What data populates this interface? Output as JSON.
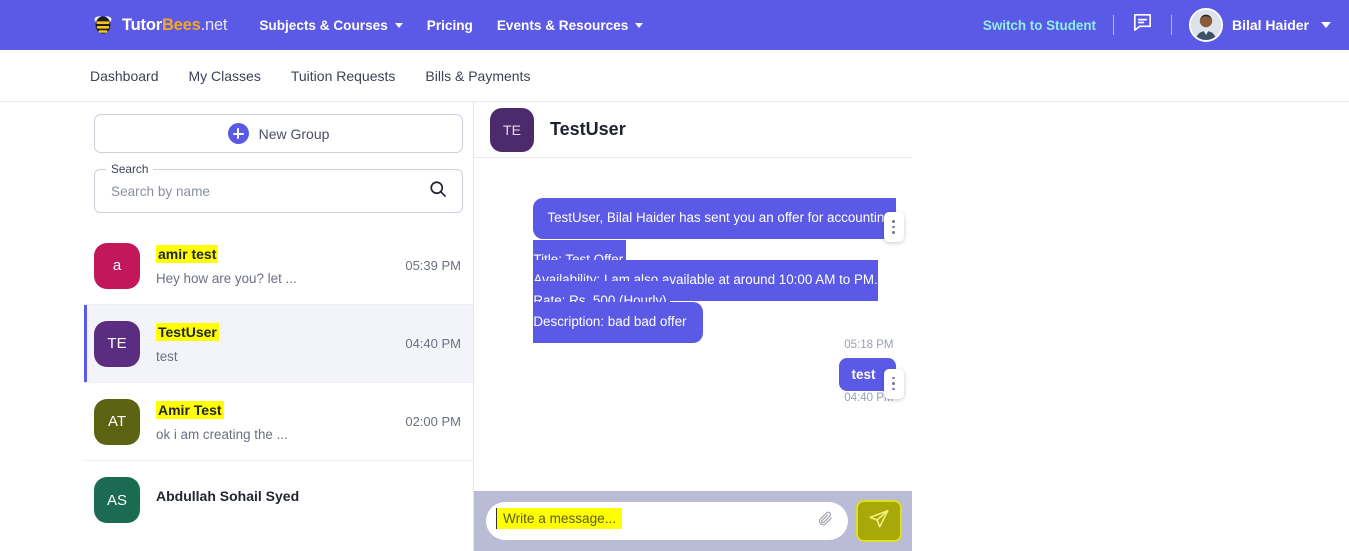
{
  "topnav": {
    "logo": {
      "part1": "Tutor",
      "part2": "Bees",
      "part3": ".net",
      "icon": "bee-icon"
    },
    "links": [
      {
        "label": "Subjects & Courses",
        "has_chevron": true
      },
      {
        "label": "Pricing",
        "has_chevron": false
      },
      {
        "label": "Events & Resources",
        "has_chevron": true
      }
    ],
    "switch_label": "Switch to Student",
    "message_icon": "chat-bubble-icon",
    "user_name": "Bilal Haider",
    "accent_color": "#5a5ae6",
    "switch_color": "#8ff0e6"
  },
  "subnav": {
    "items": [
      {
        "label": "Dashboard"
      },
      {
        "label": "My Classes"
      },
      {
        "label": "Tuition Requests"
      },
      {
        "label": "Bills & Payments"
      }
    ]
  },
  "sidebar": {
    "new_group_label": "New Group",
    "search": {
      "legend": "Search",
      "placeholder": "Search by name",
      "value": "",
      "icon": "search-icon"
    },
    "chats": [
      {
        "initials": "a",
        "avatar_color": "#c2185b",
        "name": "amir test",
        "highlight": true,
        "snippet": "Hey how are you? let ...",
        "time": "05:39 PM",
        "active": false
      },
      {
        "initials": "TE",
        "avatar_color": "#5b2d80",
        "name": "TestUser",
        "highlight": true,
        "snippet": "test",
        "time": "04:40 PM",
        "active": true
      },
      {
        "initials": "AT",
        "avatar_color": "#5c6414",
        "name": "Amir Test",
        "highlight": true,
        "snippet": "ok i am creating the ...",
        "time": "02:00 PM",
        "active": false
      },
      {
        "initials": "AS",
        "avatar_color": "#1b6b52",
        "name": "Abdullah Sohail Syed",
        "highlight": false,
        "snippet": "",
        "time": "",
        "active": false
      }
    ]
  },
  "chat": {
    "header": {
      "initials": "TE",
      "avatar_color": "#4c2a6b",
      "name": "TestUser"
    },
    "messages": [
      {
        "side": "right",
        "text": "TestUser, Bilal Haider  has sent you an offer for accounting.\n\nTitle: Test Offer.\nAvailability: I am also available at around 10:00 AM to PM.\nRate: Rs. 500 (Hourly).\nDescription: bad bad offer",
        "time": "05:18 PM",
        "kebab": "more-options-icon"
      },
      {
        "side": "right",
        "text": "test",
        "time": "04:40 PM",
        "kebab": "more-options-icon"
      }
    ],
    "composer": {
      "placeholder": "Write a message...",
      "value": "",
      "attach_icon": "paperclip-icon",
      "send_icon": "send-paper-plane-icon"
    }
  }
}
